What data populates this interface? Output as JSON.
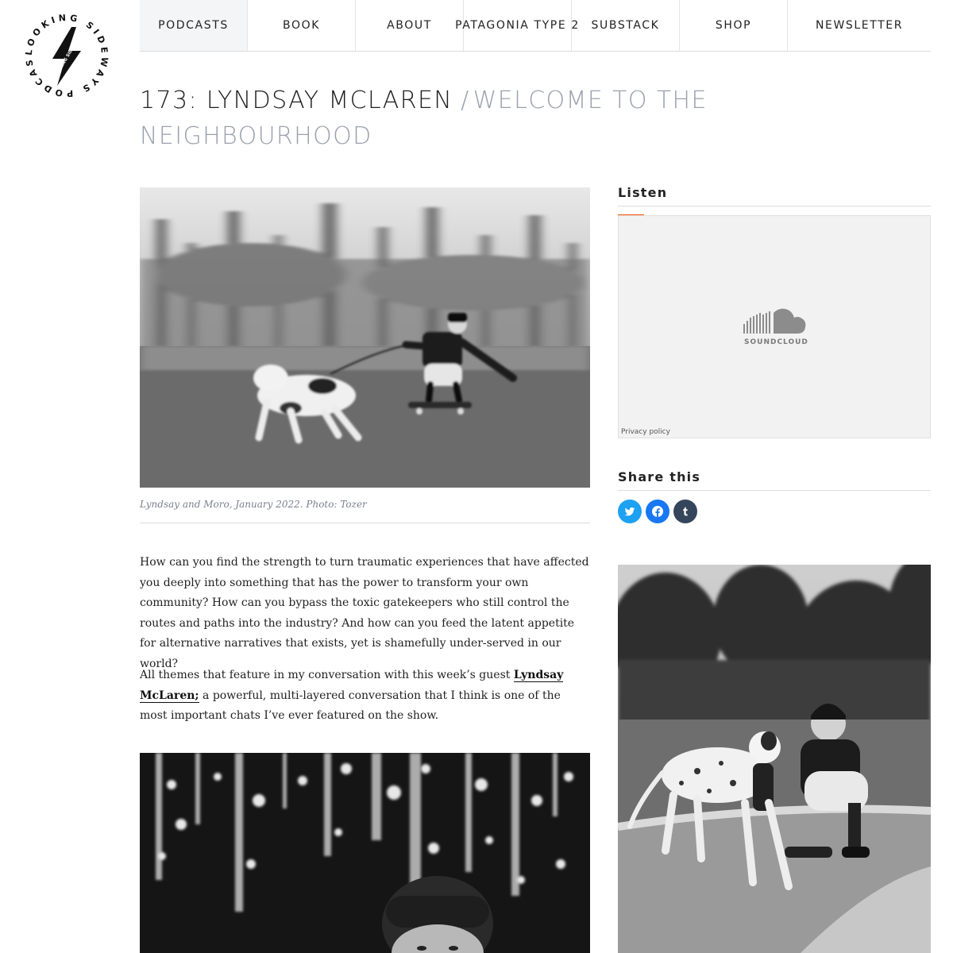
{
  "logo": {
    "ring_text": "LOOKING SIDEWAYS PODCAST",
    "center_text": "LOOKING SIDEWAYS"
  },
  "nav": [
    {
      "label": "PODCASTS",
      "active": true
    },
    {
      "label": "BOOK"
    },
    {
      "label": "ABOUT"
    },
    {
      "label": "PATAGONIA TYPE 2"
    },
    {
      "label": "SUBSTACK"
    },
    {
      "label": "SHOP"
    },
    {
      "label": "NEWSLETTER"
    }
  ],
  "post": {
    "title": "173: LYNDSAY MCLAREN",
    "separator": "/",
    "subtitle": "WELCOME TO THE NEIGHBOURHOOD",
    "hero_caption": "Lyndsay and Moro, January 2022. Photo: Tozer",
    "paragraph1": "How can you find the strength to turn traumatic experiences that have affected you deeply into something that has the power to transform your own community? How can you bypass the toxic gatekeepers who still control the routes and paths into the industry? And how can you feed the latent appetite for alternative narratives that exists, yet is shamefully under-served in our world?",
    "paragraph2_before": "All themes that feature in my conversation with this week’s guest ",
    "paragraph2_link": "Lyndsay McLaren;",
    "paragraph2_after": " a powerful, multi-layered conversation that I think is one of the most important chats I’ve ever featured on the show."
  },
  "sidebar": {
    "listen_heading": "Listen",
    "soundcloud_label": "SOUNDCLOUD",
    "privacy_label": "Privacy policy",
    "share_heading": "Share this",
    "share_buttons": [
      {
        "name": "twitter",
        "icon": "twitter-icon",
        "color": "#1da1f2"
      },
      {
        "name": "facebook",
        "icon": "facebook-icon",
        "color": "#1877f2"
      },
      {
        "name": "tumblr",
        "icon": "tumblr-icon",
        "color": "#35465c"
      }
    ]
  },
  "colors": {
    "accent": "#ff5500",
    "muted_title": "#9aa0ad",
    "nav_active_bg": "#f4f5f6"
  }
}
